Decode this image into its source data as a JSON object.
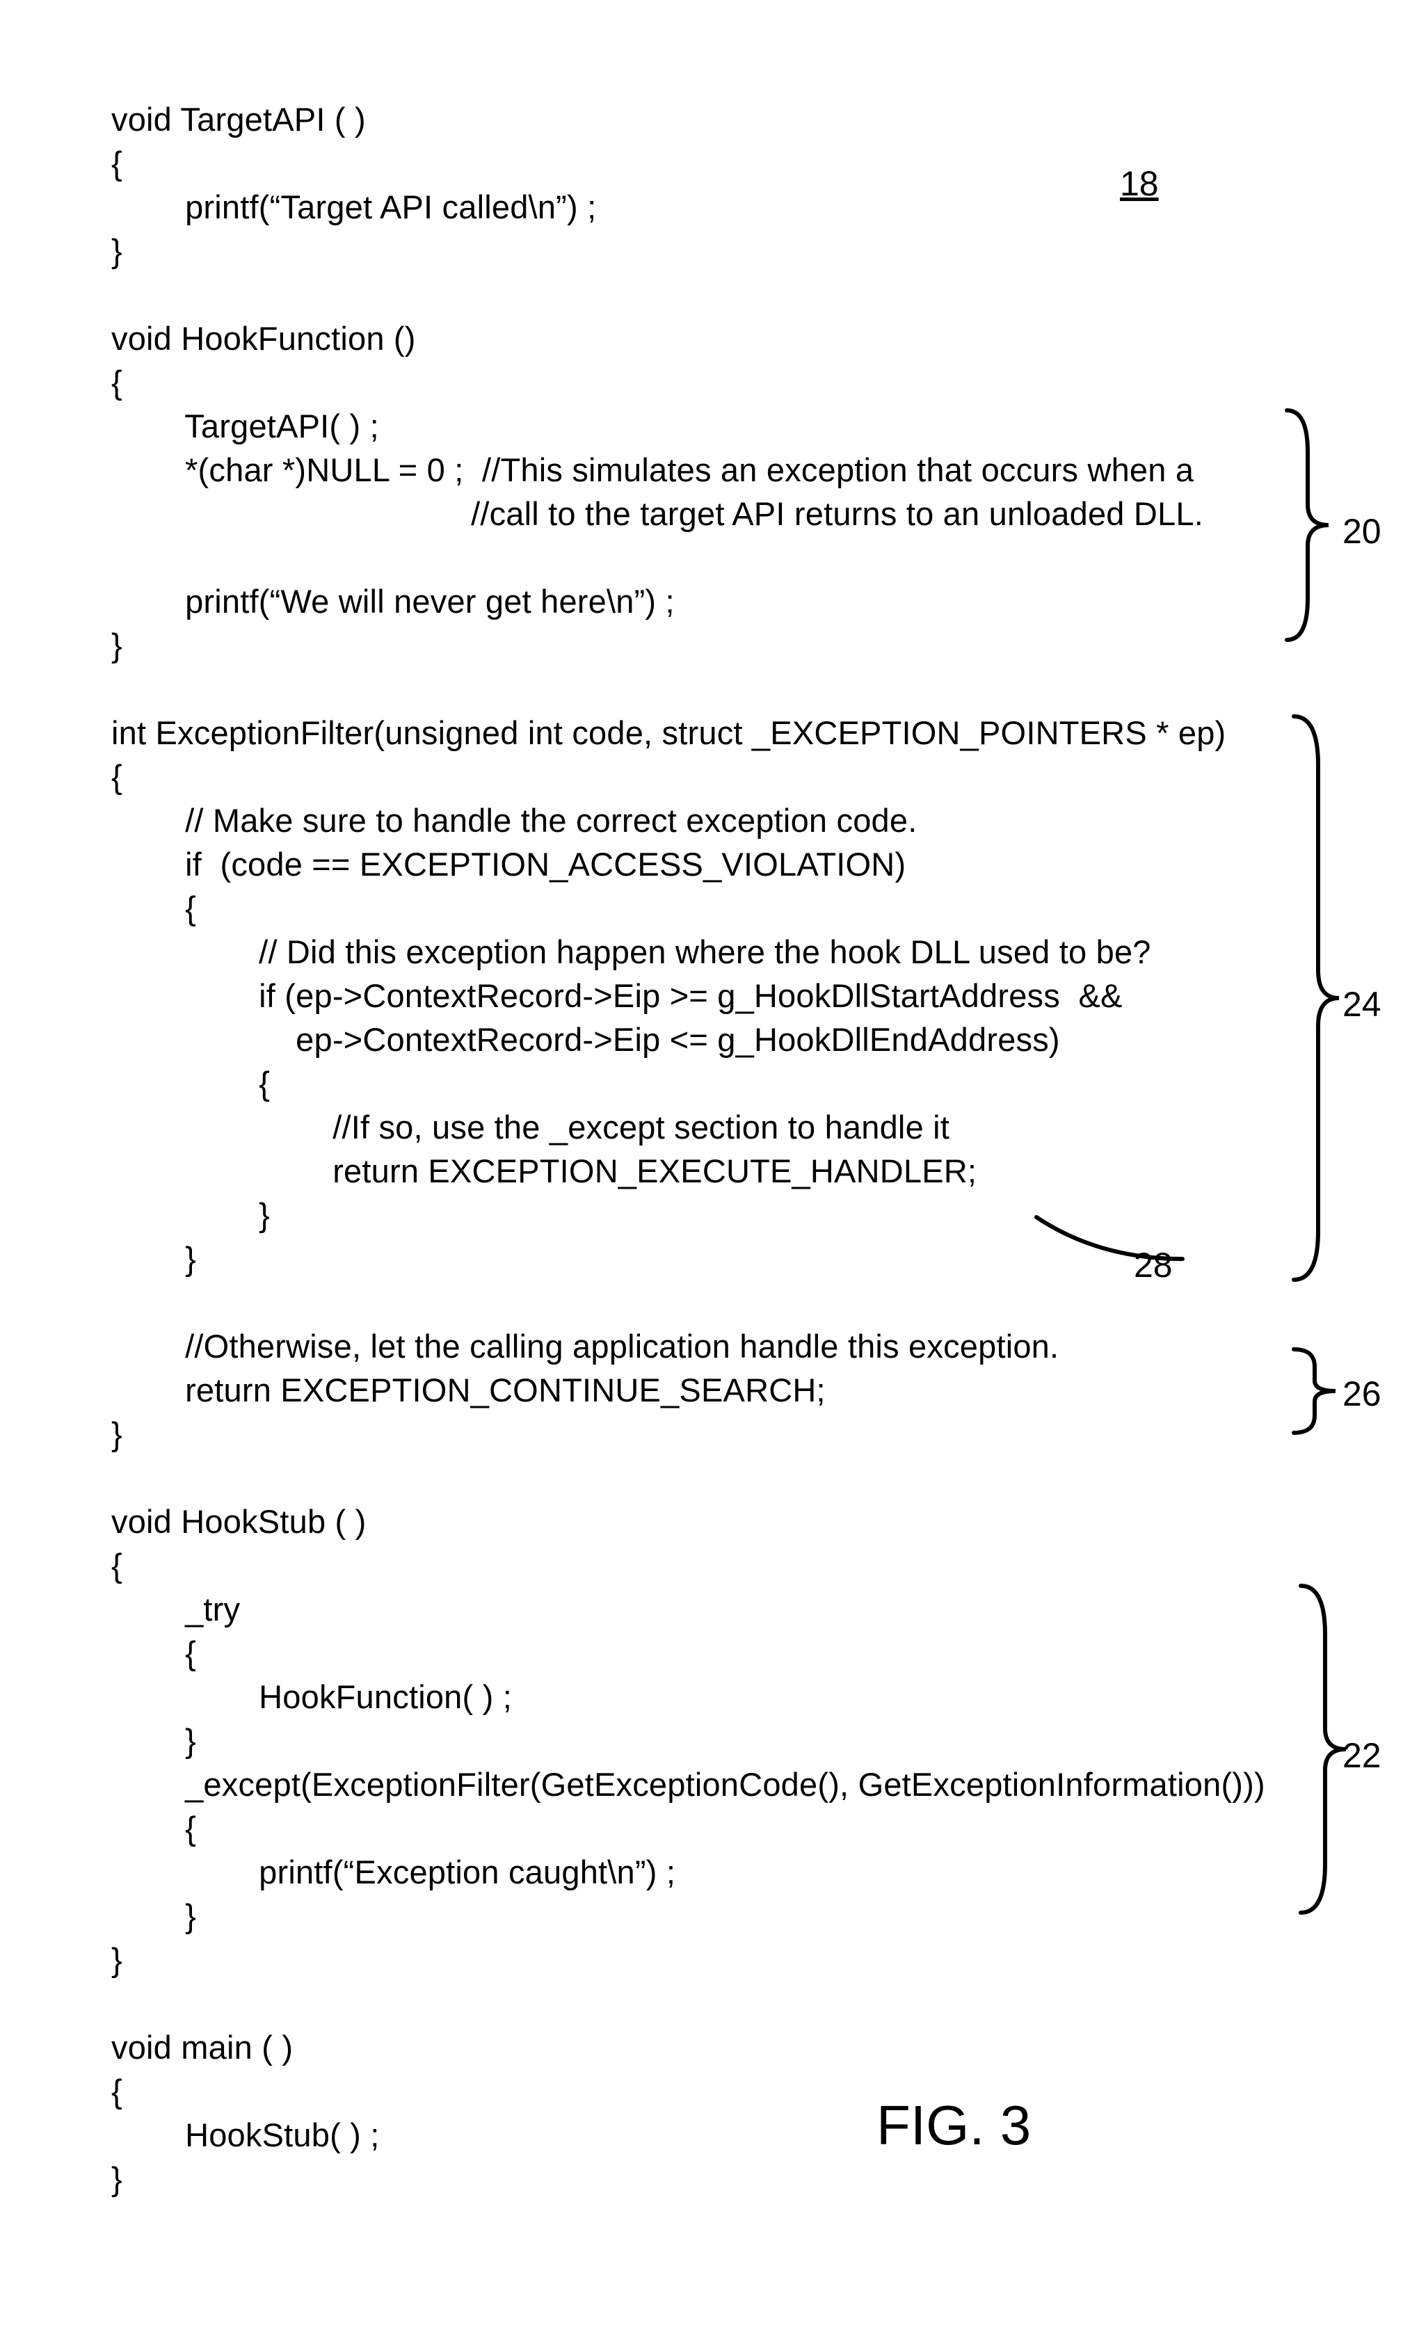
{
  "ref18": "18",
  "ann20": "20",
  "ann24": "24",
  "ann28": "28",
  "ann26": "26",
  "ann22": "22",
  "figLabel": "FIG. 3",
  "code": "void TargetAPI ( )\n{\n        printf(“Target API called\\n”) ;\n}\n\nvoid HookFunction ()\n{\n        TargetAPI( ) ;\n        *(char *)NULL = 0 ;  //This simulates an exception that occurs when a\n                                       //call to the target API returns to an unloaded DLL.\n\n        printf(“We will never get here\\n”) ;\n}\n\nint ExceptionFilter(unsigned int code, struct _EXCEPTION_POINTERS * ep)\n{\n        // Make sure to handle the correct exception code.\n        if  (code == EXCEPTION_ACCESS_VIOLATION)\n        {\n                // Did this exception happen where the hook DLL used to be?\n                if (ep->ContextRecord->Eip >= g_HookDllStartAddress  &&\n                    ep->ContextRecord->Eip <= g_HookDllEndAddress)\n                {\n                        //If so, use the _except section to handle it\n                        return EXCEPTION_EXECUTE_HANDLER;\n                }\n        }\n\n        //Otherwise, let the calling application handle this exception.\n        return EXCEPTION_CONTINUE_SEARCH;\n}\n\nvoid HookStub ( )\n{\n        _try\n        {\n                HookFunction( ) ;\n        }\n        _except(ExceptionFilter(GetExceptionCode(), GetExceptionInformation()))\n        {\n                printf(“Exception caught\\n”) ;\n        }\n}\n\nvoid main ( )\n{\n        HookStub( ) ;\n}"
}
